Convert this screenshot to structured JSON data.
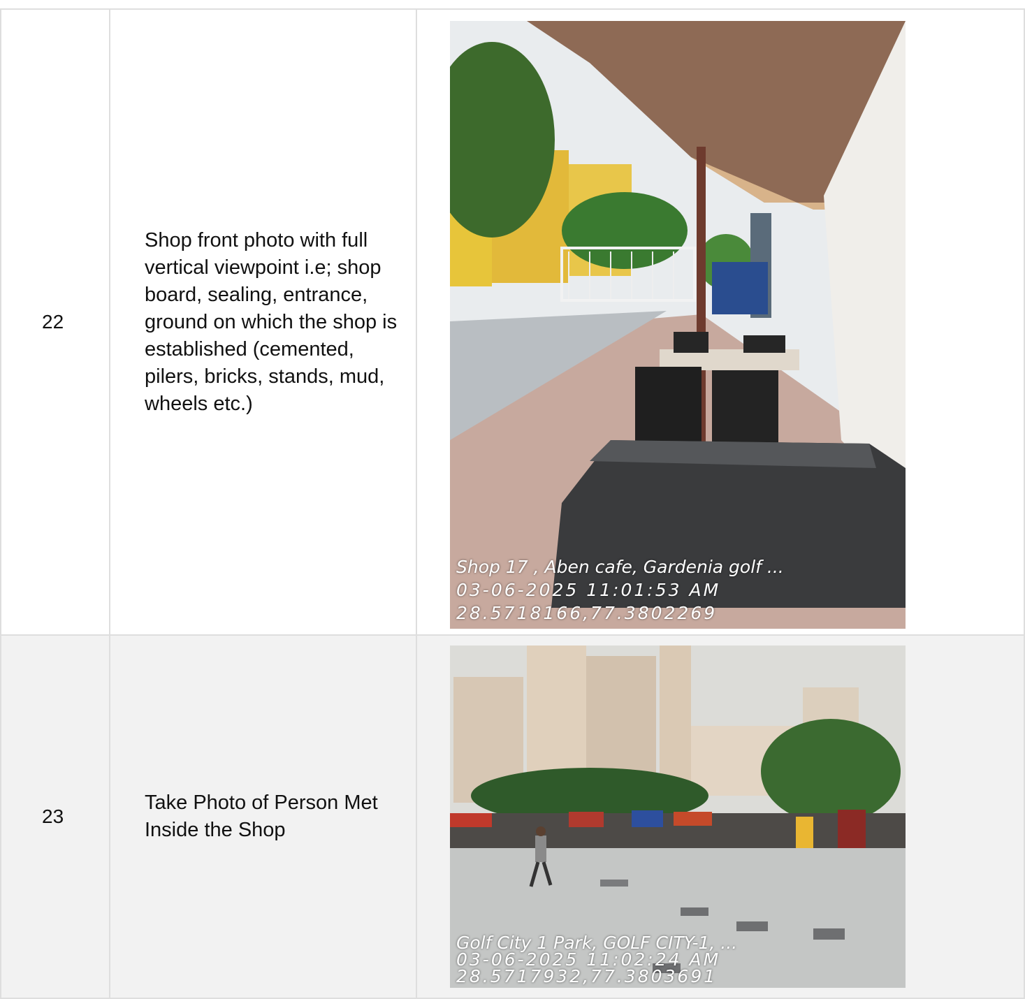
{
  "rows": [
    {
      "number": "22",
      "description": "Shop front photo with full vertical viewpoint i.e; shop board, sealing, entrance, ground on which the shop is established (cemented, pilers, bricks, stands, mud, wheels etc.)",
      "photo": {
        "stamp_location": "Shop 17 , Aben cafe, Gardenia golf ...",
        "stamp_datetime": "03-06-2025 11:01:53 AM",
        "stamp_coordinates": "28.5718166,77.3802269"
      }
    },
    {
      "number": "23",
      "description": "Take Photo of Person Met Inside the Shop",
      "photo": {
        "stamp_location": "Golf City 1 Park, GOLF CITY-1, ...",
        "stamp_datetime": "03-06-2025 11:02:24 AM",
        "stamp_coordinates": "28.5717932,77.3803691"
      }
    }
  ]
}
